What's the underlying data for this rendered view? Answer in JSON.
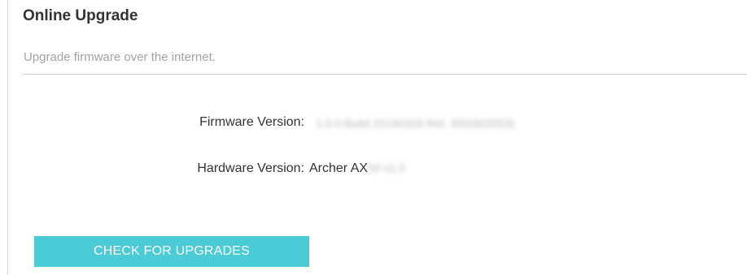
{
  "header": {
    "title": "Online Upgrade",
    "description": "Upgrade firmware over the internet."
  },
  "firmware": {
    "label": "Firmware Version:",
    "value": "1.0.0 Build 20190326 Rel. 30026(5553)"
  },
  "hardware": {
    "label": "Hardware Version:",
    "value_prefix": "Archer AX",
    "value_suffix": "50 v1.0"
  },
  "actions": {
    "check_label": "CHECK FOR UPGRADES"
  },
  "colors": {
    "button_bg": "#4acbd6",
    "button_text": "#ffffff",
    "title_text": "#333333",
    "description_text": "#a3a3a3"
  }
}
